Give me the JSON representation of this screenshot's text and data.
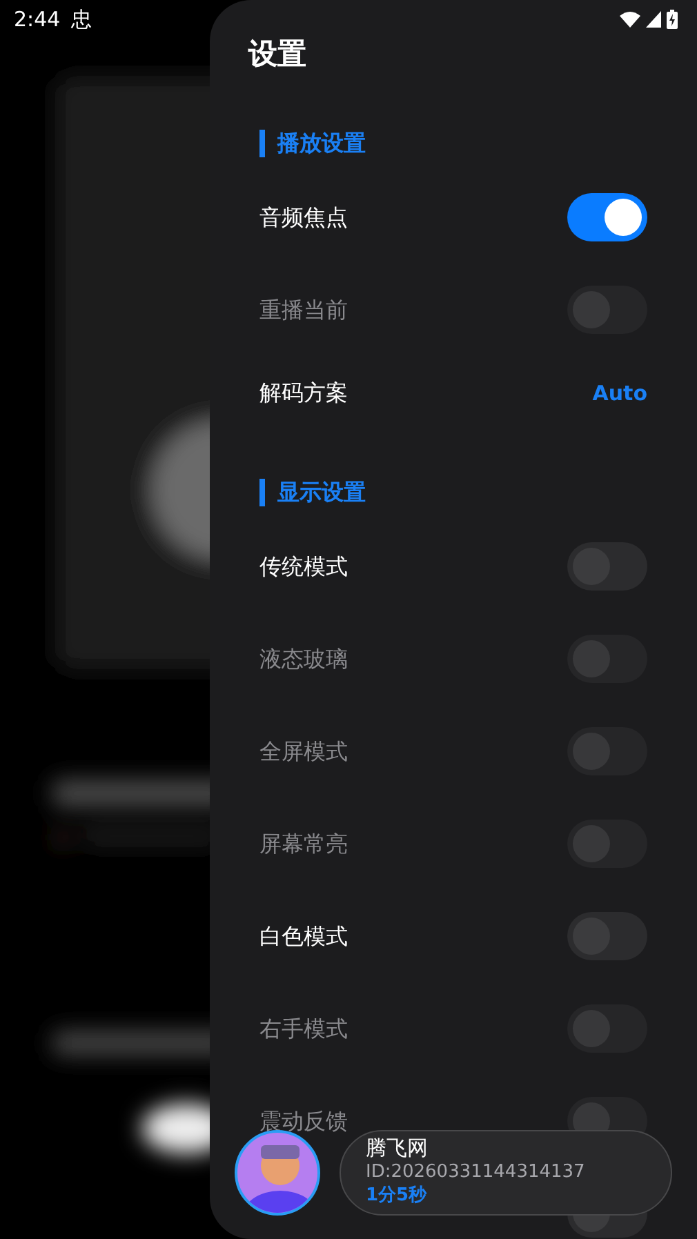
{
  "status_bar": {
    "time": "2:44",
    "notification": "忠"
  },
  "title": "设置",
  "sections": [
    {
      "title": "播放设置",
      "items": [
        {
          "kind": "toggle",
          "label": "音频焦点",
          "on": true,
          "disabled": false
        },
        {
          "kind": "toggle",
          "label": "重播当前",
          "on": false,
          "disabled": true
        },
        {
          "kind": "value",
          "label": "解码方案",
          "value": "Auto",
          "disabled": false
        }
      ]
    },
    {
      "title": "显示设置",
      "items": [
        {
          "kind": "toggle",
          "label": "传统模式",
          "on": false,
          "disabled": false
        },
        {
          "kind": "toggle",
          "label": "液态玻璃",
          "on": false,
          "disabled": true
        },
        {
          "kind": "toggle",
          "label": "全屏模式",
          "on": false,
          "disabled": true
        },
        {
          "kind": "toggle",
          "label": "屏幕常亮",
          "on": false,
          "disabled": true
        },
        {
          "kind": "toggle",
          "label": "白色模式",
          "on": false,
          "disabled": false
        },
        {
          "kind": "toggle",
          "label": "右手模式",
          "on": false,
          "disabled": true
        },
        {
          "kind": "toggle",
          "label": "震动反馈",
          "on": false,
          "disabled": true
        },
        {
          "kind": "toggle",
          "on": false
        }
      ]
    }
  ],
  "user_card": {
    "name": "腾飞网",
    "id": "ID:20260331144314137",
    "duration": "1分5秒"
  }
}
